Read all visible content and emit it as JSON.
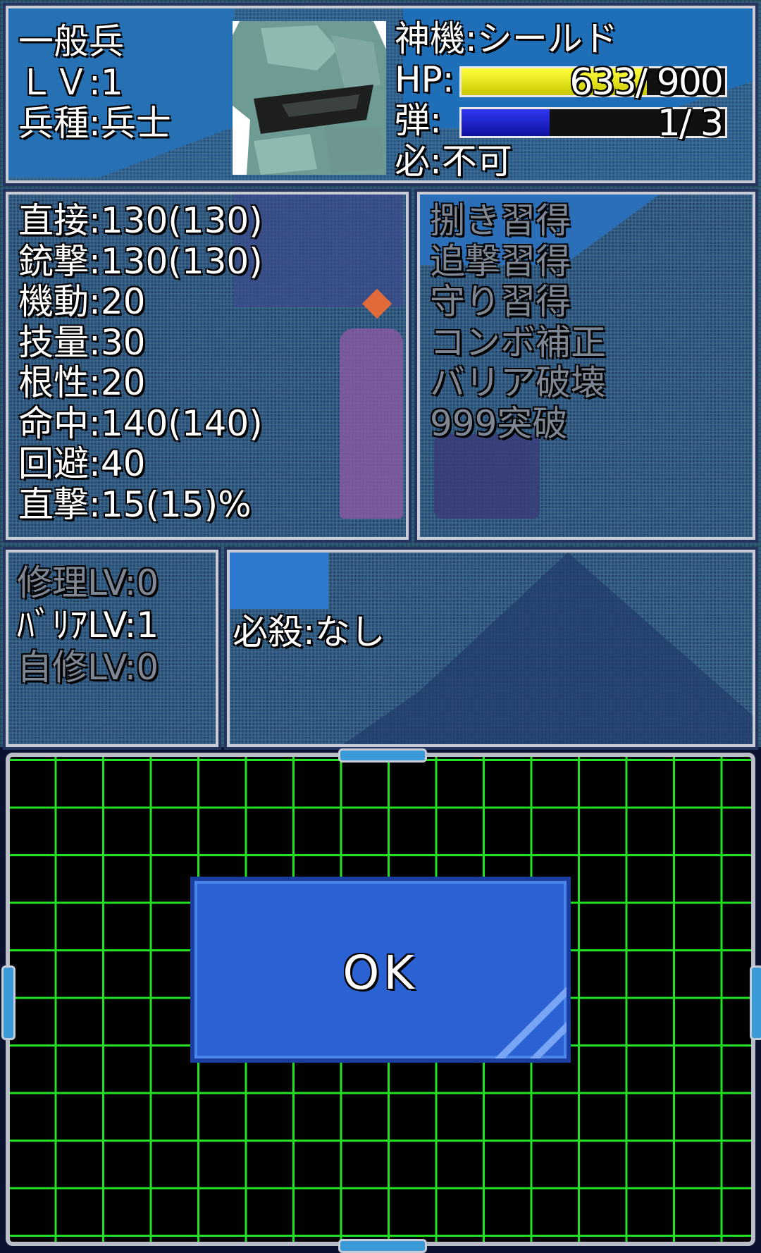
{
  "unit": {
    "name": "一般兵",
    "level": "ＬＶ:1",
    "class": "兵種:兵士",
    "machine": "神機:シールド",
    "hp_label": "HP:",
    "hp_current": "633",
    "hp_max": "900",
    "hp_fraction": 0.703,
    "ammo_label": "弾:",
    "ammo_current": "1",
    "ammo_max": "3",
    "ammo_fraction": 0.333,
    "special": "必:不可"
  },
  "stats": [
    "直接:130(130)",
    "銃撃:130(130)",
    "機動:20",
    "技量:30",
    "根性:20",
    "命中:140(140)",
    "回避:40",
    "直撃:15(15)%"
  ],
  "skills": [
    "捌き習得",
    "追撃習得",
    "守り習得",
    "コンボ補正",
    "バリア破壊",
    "999突破"
  ],
  "abilities": [
    {
      "text": "修理LV:0",
      "active": false
    },
    {
      "text": "ﾊﾞﾘｱLV:1",
      "active": true
    },
    {
      "text": "自修LV:0",
      "active": false
    }
  ],
  "finisher": "必殺:なし",
  "ok_button": "OK",
  "colors": {
    "hp_bar": "#e8e800",
    "ammo_bar": "#1a22d8",
    "grid_line": "#22e022",
    "ok_button": "#2a62d4"
  }
}
